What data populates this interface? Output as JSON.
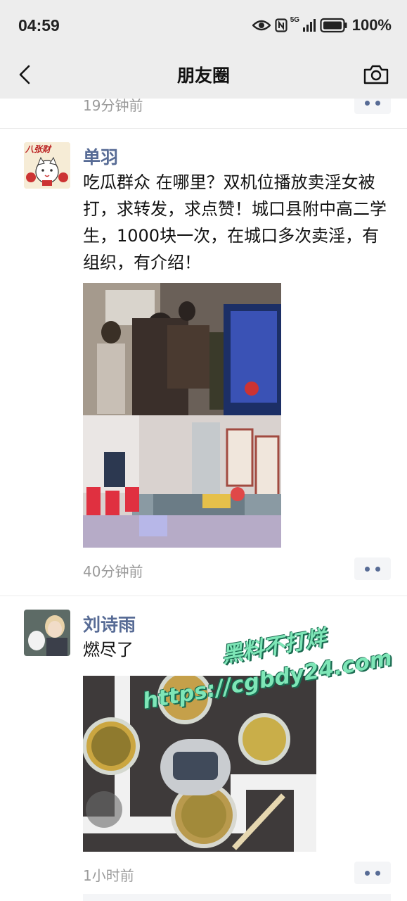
{
  "status_bar": {
    "time": "04:59",
    "signal_label": "5G",
    "battery": "100%"
  },
  "nav": {
    "title": "朋友圈",
    "back_icon": "chevron-left-icon",
    "camera_icon": "camera-icon"
  },
  "feed": {
    "partial_timestamp": "19分钟前",
    "posts": [
      {
        "author": "单羽",
        "text": "吃瓜群众 在哪里？双机位播放卖淫女被打，求转发，求点赞！城口县附中高二学生，1000块一次，在城口多次卖淫，有组织，有介绍！",
        "timestamp": "40分钟前",
        "avatar_text": "八张财"
      },
      {
        "author": "刘诗雨",
        "text": "燃尽了",
        "timestamp": "1小时前"
      }
    ]
  },
  "watermark": {
    "line1": "黑料不打烊",
    "line2": "https://cgbdy24.com"
  },
  "colors": {
    "name_blue": "#576b95",
    "bar_gray": "#ededed"
  }
}
